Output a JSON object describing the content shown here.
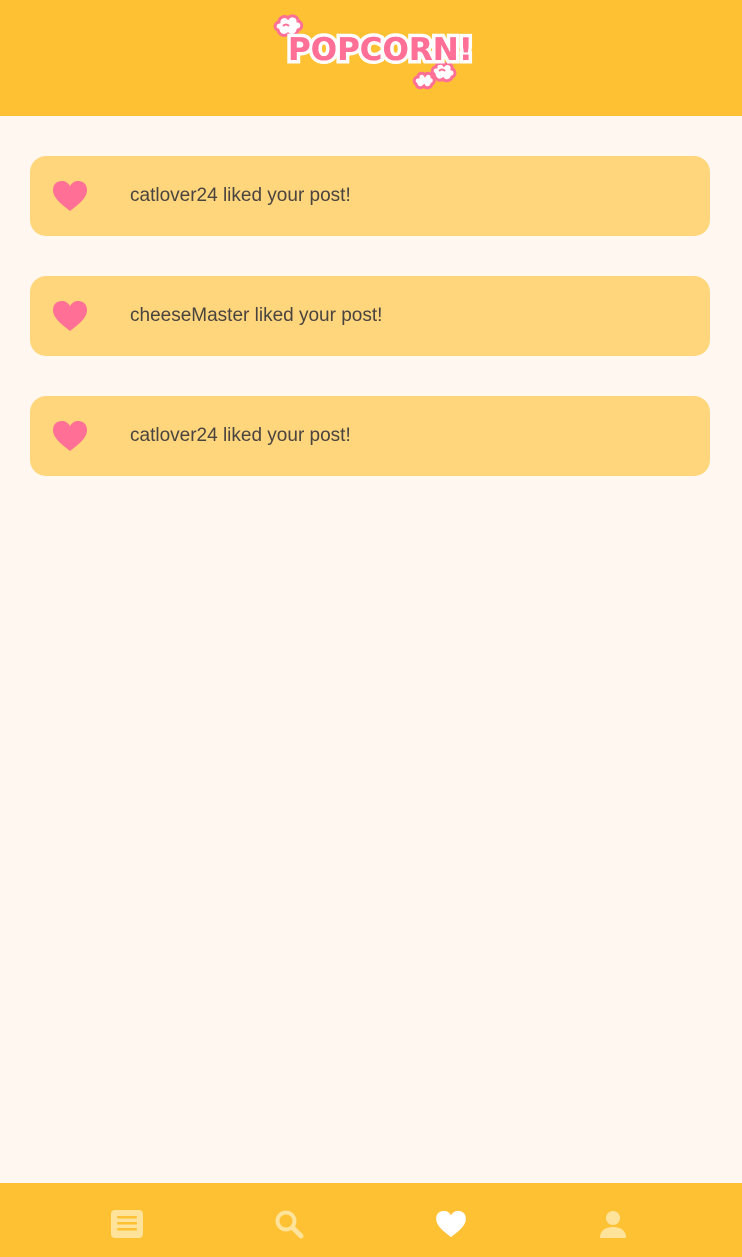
{
  "app": {
    "logo_text": "POPCORN!"
  },
  "colors": {
    "header_bg": "#ffc134",
    "page_bg": "#fff7f0",
    "card_bg": "#ffd67b",
    "heart": "#ff6f96",
    "text": "#4a4440"
  },
  "notifications": [
    {
      "icon": "heart-icon",
      "user": "catlover24",
      "message": " liked your post!"
    },
    {
      "icon": "heart-icon",
      "user": "cheeseMaster",
      "message": " liked your post!"
    },
    {
      "icon": "heart-icon",
      "user": "catlover24",
      "message": " liked your post!"
    }
  ],
  "nav": {
    "items": [
      {
        "icon": "feed-icon",
        "active": false
      },
      {
        "icon": "search-icon",
        "active": false
      },
      {
        "icon": "heart-icon",
        "active": true
      },
      {
        "icon": "profile-icon",
        "active": false
      }
    ]
  }
}
